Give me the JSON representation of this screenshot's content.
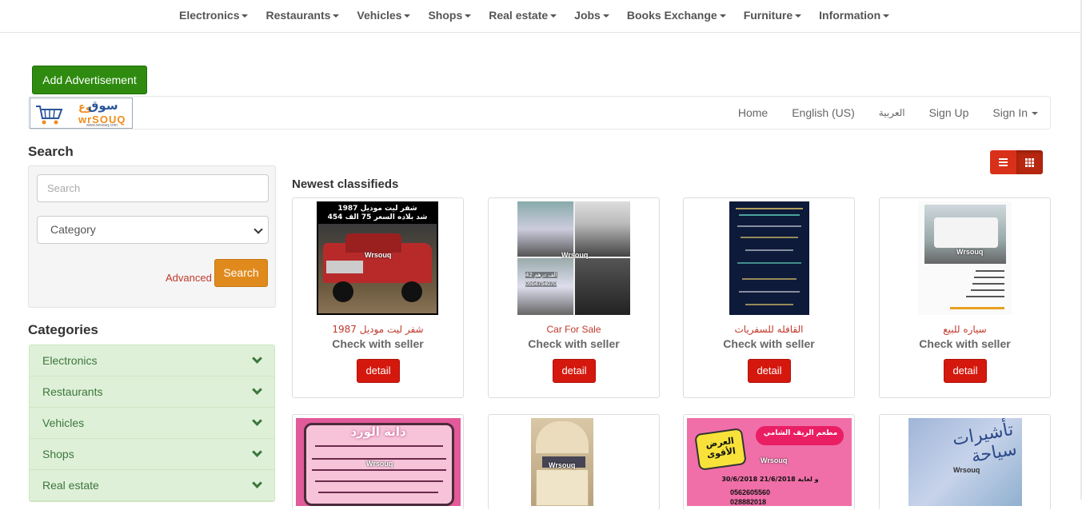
{
  "top_nav": {
    "items": [
      {
        "label": "Electronics"
      },
      {
        "label": "Restaurants"
      },
      {
        "label": "Vehicles"
      },
      {
        "label": "Shops"
      },
      {
        "label": "Real estate"
      },
      {
        "label": "Jobs"
      },
      {
        "label": "Books Exchange"
      },
      {
        "label": "Furniture"
      },
      {
        "label": "Information"
      }
    ]
  },
  "add_button": {
    "label": "Add Advertisement"
  },
  "header": {
    "logo": {
      "arabic": "سوق",
      "arabic_small": "وع",
      "english": "wrSOUQ",
      "url": "www.wrsouq.com"
    },
    "nav": {
      "home": "Home",
      "english": "English (US)",
      "arabic": "العربية",
      "signup": "Sign Up",
      "signin": "Sign In"
    }
  },
  "search": {
    "heading": "Search",
    "placeholder": "Search",
    "category_value": "Category",
    "advanced_label": "Advanced",
    "button_label": "Search"
  },
  "categories": {
    "heading": "Categories",
    "items": [
      {
        "label": "Electronics"
      },
      {
        "label": "Restaurants"
      },
      {
        "label": "Vehicles"
      },
      {
        "label": "Shops"
      },
      {
        "label": "Real estate"
      }
    ]
  },
  "listing": {
    "heading": "Newest classifieds",
    "detail_label": "detail",
    "cards": [
      {
        "title": "شفر ليت موديل 1987",
        "price": "Check with seller"
      },
      {
        "title": "Car For Sale",
        "price": "Check with seller"
      },
      {
        "title": "القافله للسفريات",
        "price": "Check with seller"
      },
      {
        "title": "سياره للبيع",
        "price": "Check with seller"
      }
    ],
    "thumb_text": {
      "truck_line1": "شفر ليت موديل 1987",
      "truck_line2": "454 شد بلاده السعر 75 الف",
      "watermark": "Wrsouq",
      "car_price": "42 الف درهم",
      "car_phone": "0504754070",
      "flower_title": "دانة الورد",
      "offer_badge": "العرض الأقوى",
      "restaurant_name": "مطعم الريف الشامي",
      "restaurant_dates": "30/6/2018 و لغاية 21/6/2018",
      "restaurant_phone1": "0562605560",
      "restaurant_phone2": "028882018",
      "visa_text": "تأشيرات سياحة"
    }
  },
  "colors": {
    "add_button": "#2e8b10",
    "search_button": "#e08a1e",
    "detail_button": "#d5180e",
    "category_bg": "#dff0d8",
    "category_text": "#3c763d",
    "link_red": "#c0392b"
  }
}
